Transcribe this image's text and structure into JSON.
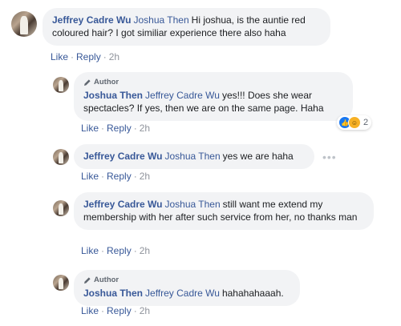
{
  "comments": [
    {
      "author": "Jeffrey Cadre Wu",
      "mention": "Joshua Then",
      "text": "Hi joshua, is the auntie red coloured hair? I got similiar experience there also haha",
      "like_label": "Like",
      "reply_label": "Reply",
      "time": "2h"
    },
    {
      "author_badge": "Author",
      "author": "Joshua Then",
      "mention": "Jeffrey Cadre Wu",
      "text": "yes!!! Does she wear spectacles? If yes, then we are on the same page. Haha",
      "like_label": "Like",
      "reply_label": "Reply",
      "time": "2h",
      "reactions": {
        "types": [
          "like-icon",
          "haha-icon"
        ],
        "count": "2"
      }
    },
    {
      "author": "Jeffrey Cadre Wu",
      "mention": "Joshua Then",
      "text": "yes we are haha",
      "like_label": "Like",
      "reply_label": "Reply",
      "time": "2h",
      "more_label": "•••"
    },
    {
      "author": "Jeffrey Cadre Wu",
      "mention": "Joshua Then",
      "text": "still want me extend my membership with her after such service from her, no thanks man",
      "like_label": "Like",
      "reply_label": "Reply",
      "time": "2h"
    },
    {
      "author_badge": "Author",
      "author": "Joshua Then",
      "mention": "Jeffrey Cadre Wu",
      "text": "hahahahaaah.",
      "like_label": "Like",
      "reply_label": "Reply",
      "time": "2h"
    }
  ],
  "colors": {
    "link": "#385898",
    "bubble": "#f2f3f5",
    "meta": "#90949c"
  }
}
